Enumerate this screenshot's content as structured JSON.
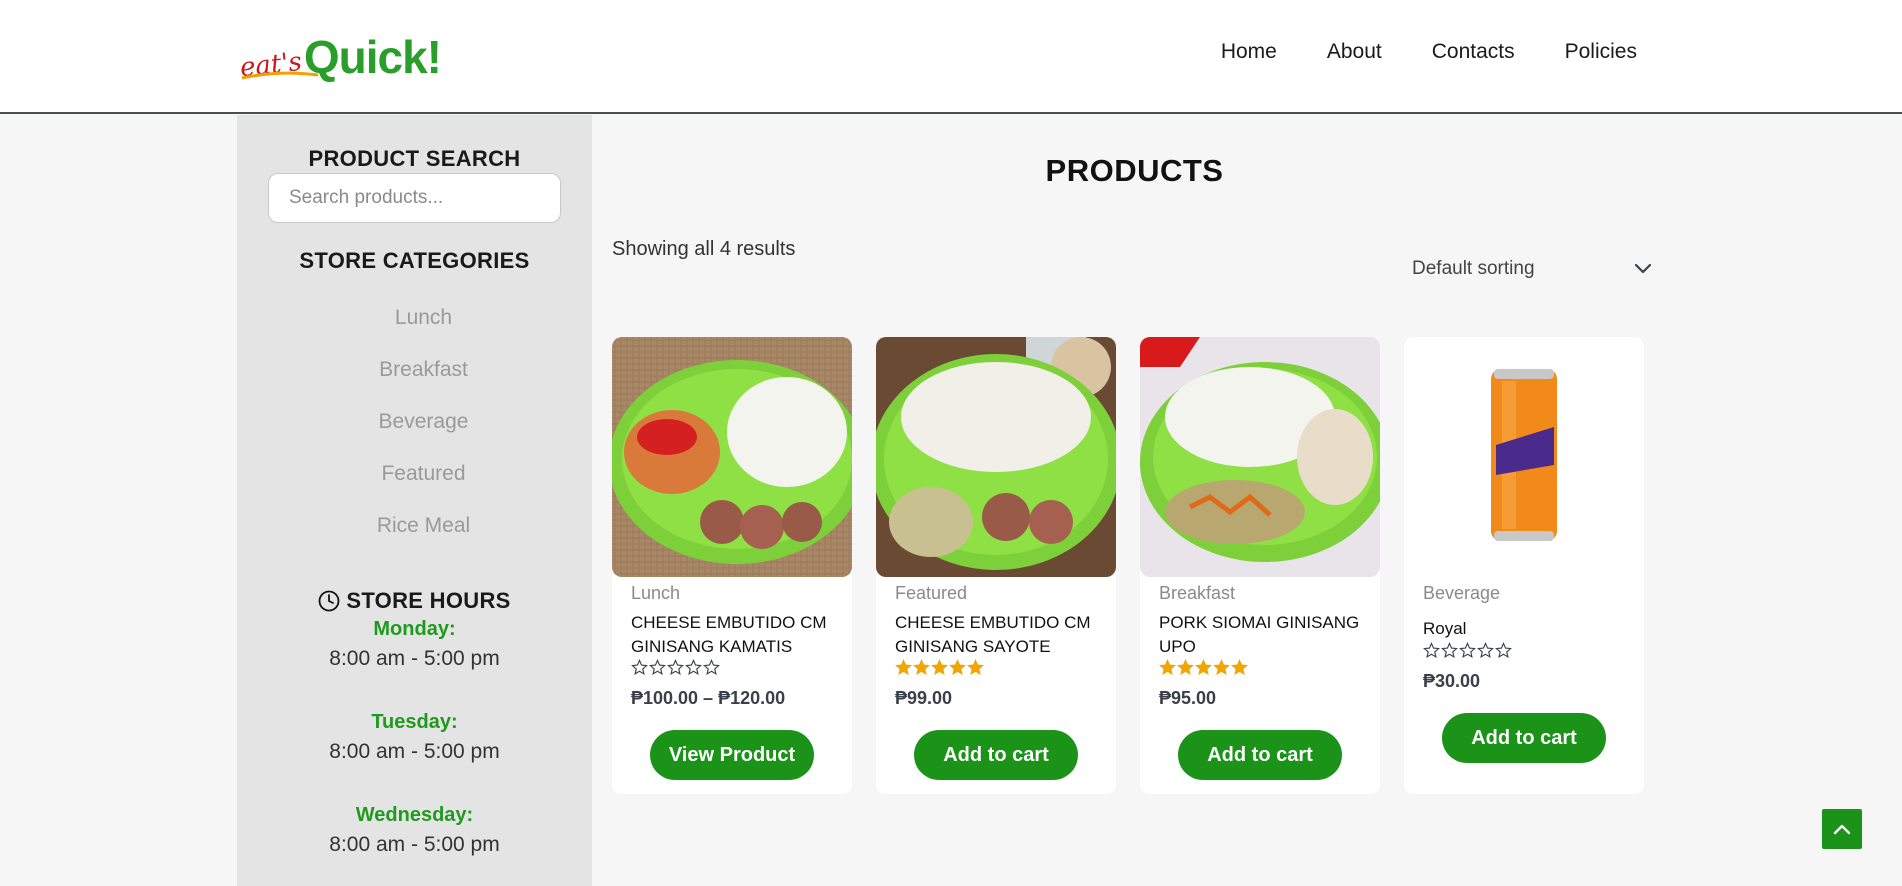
{
  "header": {
    "logo_small": "eat's",
    "logo_big": "Quick!",
    "nav": [
      "Home",
      "About",
      "Contacts",
      "Policies"
    ]
  },
  "sidebar": {
    "search_heading": "PRODUCT SEARCH",
    "search_placeholder": "Search products...",
    "categories_heading": "STORE CATEGORIES",
    "categories": [
      "Lunch",
      "Breakfast",
      "Beverage",
      "Featured",
      "Rice Meal"
    ],
    "hours_heading": "STORE HOURS",
    "hours": [
      {
        "day": "Monday:",
        "time": "8:00 am - 5:00 pm"
      },
      {
        "day": "Tuesday:",
        "time": "8:00 am - 5:00 pm"
      },
      {
        "day": "Wednesday:",
        "time": "8:00 am - 5:00 pm"
      }
    ]
  },
  "main": {
    "title": "PRODUCTS",
    "result_count": "Showing all 4 results",
    "sorting": "Default sorting",
    "products": [
      {
        "category": "Lunch",
        "name": "CHEESE EMBUTIDO CM GINISANG KAMATIS",
        "rating": 0,
        "price": "₱100.00 – ₱120.00",
        "button": "View Product"
      },
      {
        "category": "Featured",
        "name": "CHEESE EMBUTIDO CM GINISANG SAYOTE",
        "rating": 5,
        "price": "₱99.00",
        "button": "Add to cart"
      },
      {
        "category": "Breakfast",
        "name": "PORK SIOMAI GINISANG UPO",
        "rating": 5,
        "price": "₱95.00",
        "button": "Add to cart"
      },
      {
        "category": "Beverage",
        "name": "Royal",
        "rating": 0,
        "price": "₱30.00",
        "button": "Add to cart"
      }
    ]
  },
  "colors": {
    "accent": "#1a9318",
    "day_label": "#1f9a1f",
    "star": "#f0a500"
  }
}
